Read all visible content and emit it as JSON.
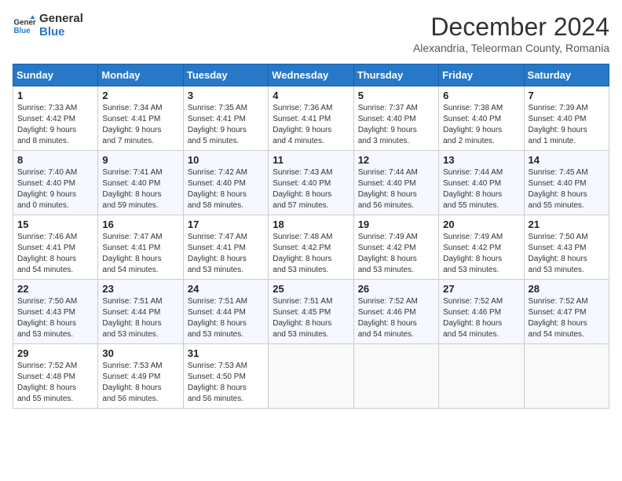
{
  "logo": {
    "general": "General",
    "blue": "Blue"
  },
  "title": "December 2024",
  "subtitle": "Alexandria, Teleorman County, Romania",
  "days_header": [
    "Sunday",
    "Monday",
    "Tuesday",
    "Wednesday",
    "Thursday",
    "Friday",
    "Saturday"
  ],
  "weeks": [
    [
      {
        "day": "1",
        "info": "Sunrise: 7:33 AM\nSunset: 4:42 PM\nDaylight: 9 hours\nand 8 minutes."
      },
      {
        "day": "2",
        "info": "Sunrise: 7:34 AM\nSunset: 4:41 PM\nDaylight: 9 hours\nand 7 minutes."
      },
      {
        "day": "3",
        "info": "Sunrise: 7:35 AM\nSunset: 4:41 PM\nDaylight: 9 hours\nand 5 minutes."
      },
      {
        "day": "4",
        "info": "Sunrise: 7:36 AM\nSunset: 4:41 PM\nDaylight: 9 hours\nand 4 minutes."
      },
      {
        "day": "5",
        "info": "Sunrise: 7:37 AM\nSunset: 4:40 PM\nDaylight: 9 hours\nand 3 minutes."
      },
      {
        "day": "6",
        "info": "Sunrise: 7:38 AM\nSunset: 4:40 PM\nDaylight: 9 hours\nand 2 minutes."
      },
      {
        "day": "7",
        "info": "Sunrise: 7:39 AM\nSunset: 4:40 PM\nDaylight: 9 hours\nand 1 minute."
      }
    ],
    [
      {
        "day": "8",
        "info": "Sunrise: 7:40 AM\nSunset: 4:40 PM\nDaylight: 9 hours\nand 0 minutes."
      },
      {
        "day": "9",
        "info": "Sunrise: 7:41 AM\nSunset: 4:40 PM\nDaylight: 8 hours\nand 59 minutes."
      },
      {
        "day": "10",
        "info": "Sunrise: 7:42 AM\nSunset: 4:40 PM\nDaylight: 8 hours\nand 58 minutes."
      },
      {
        "day": "11",
        "info": "Sunrise: 7:43 AM\nSunset: 4:40 PM\nDaylight: 8 hours\nand 57 minutes."
      },
      {
        "day": "12",
        "info": "Sunrise: 7:44 AM\nSunset: 4:40 PM\nDaylight: 8 hours\nand 56 minutes."
      },
      {
        "day": "13",
        "info": "Sunrise: 7:44 AM\nSunset: 4:40 PM\nDaylight: 8 hours\nand 55 minutes."
      },
      {
        "day": "14",
        "info": "Sunrise: 7:45 AM\nSunset: 4:40 PM\nDaylight: 8 hours\nand 55 minutes."
      }
    ],
    [
      {
        "day": "15",
        "info": "Sunrise: 7:46 AM\nSunset: 4:41 PM\nDaylight: 8 hours\nand 54 minutes."
      },
      {
        "day": "16",
        "info": "Sunrise: 7:47 AM\nSunset: 4:41 PM\nDaylight: 8 hours\nand 54 minutes."
      },
      {
        "day": "17",
        "info": "Sunrise: 7:47 AM\nSunset: 4:41 PM\nDaylight: 8 hours\nand 53 minutes."
      },
      {
        "day": "18",
        "info": "Sunrise: 7:48 AM\nSunset: 4:42 PM\nDaylight: 8 hours\nand 53 minutes."
      },
      {
        "day": "19",
        "info": "Sunrise: 7:49 AM\nSunset: 4:42 PM\nDaylight: 8 hours\nand 53 minutes."
      },
      {
        "day": "20",
        "info": "Sunrise: 7:49 AM\nSunset: 4:42 PM\nDaylight: 8 hours\nand 53 minutes."
      },
      {
        "day": "21",
        "info": "Sunrise: 7:50 AM\nSunset: 4:43 PM\nDaylight: 8 hours\nand 53 minutes."
      }
    ],
    [
      {
        "day": "22",
        "info": "Sunrise: 7:50 AM\nSunset: 4:43 PM\nDaylight: 8 hours\nand 53 minutes."
      },
      {
        "day": "23",
        "info": "Sunrise: 7:51 AM\nSunset: 4:44 PM\nDaylight: 8 hours\nand 53 minutes."
      },
      {
        "day": "24",
        "info": "Sunrise: 7:51 AM\nSunset: 4:44 PM\nDaylight: 8 hours\nand 53 minutes."
      },
      {
        "day": "25",
        "info": "Sunrise: 7:51 AM\nSunset: 4:45 PM\nDaylight: 8 hours\nand 53 minutes."
      },
      {
        "day": "26",
        "info": "Sunrise: 7:52 AM\nSunset: 4:46 PM\nDaylight: 8 hours\nand 54 minutes."
      },
      {
        "day": "27",
        "info": "Sunrise: 7:52 AM\nSunset: 4:46 PM\nDaylight: 8 hours\nand 54 minutes."
      },
      {
        "day": "28",
        "info": "Sunrise: 7:52 AM\nSunset: 4:47 PM\nDaylight: 8 hours\nand 54 minutes."
      }
    ],
    [
      {
        "day": "29",
        "info": "Sunrise: 7:52 AM\nSunset: 4:48 PM\nDaylight: 8 hours\nand 55 minutes."
      },
      {
        "day": "30",
        "info": "Sunrise: 7:53 AM\nSunset: 4:49 PM\nDaylight: 8 hours\nand 56 minutes."
      },
      {
        "day": "31",
        "info": "Sunrise: 7:53 AM\nSunset: 4:50 PM\nDaylight: 8 hours\nand 56 minutes."
      },
      {
        "day": "",
        "info": ""
      },
      {
        "day": "",
        "info": ""
      },
      {
        "day": "",
        "info": ""
      },
      {
        "day": "",
        "info": ""
      }
    ]
  ]
}
